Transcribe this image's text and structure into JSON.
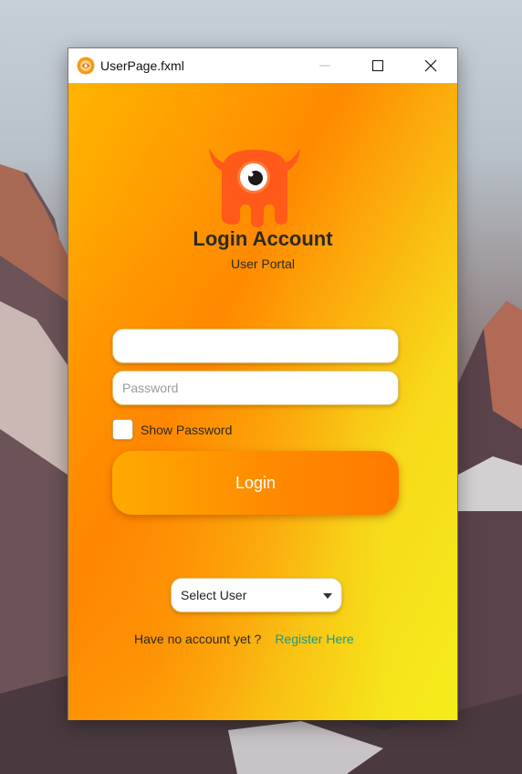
{
  "window": {
    "title": "UserPage.fxml",
    "app_icon": "java-fx-icon",
    "controls": [
      "minimize-icon",
      "maximize-icon",
      "close-icon"
    ]
  },
  "login": {
    "logo_icon": "monster-mascot-icon",
    "heading": "Login Account",
    "subheading": "User Portal",
    "username_value": "",
    "password_placeholder": "Password",
    "show_password_label": "Show Password",
    "show_password_checked": false,
    "login_button_label": "Login",
    "select_user_value": "Select User",
    "no_account_text": "Have no account yet ?",
    "register_link": "Register Here"
  },
  "colors": {
    "gradient_start": "#ffb400",
    "gradient_mid": "#ff8a00",
    "gradient_end": "#f5ec1a",
    "logo": "#ff5a1a",
    "link": "#1a9a8a"
  }
}
